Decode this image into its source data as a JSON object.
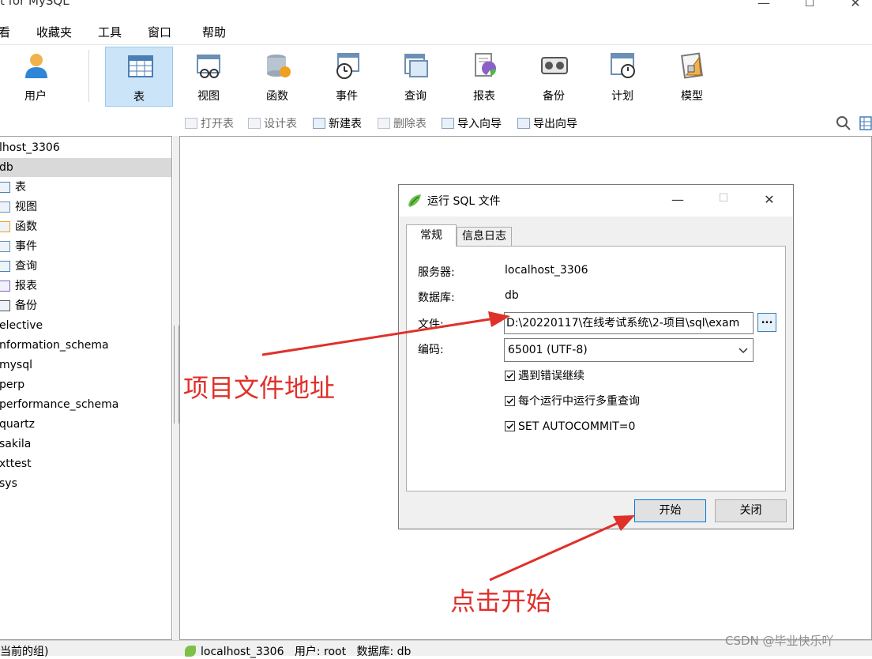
{
  "window": {
    "title_partial": "t for MySQL",
    "minimize": "—",
    "maximize": "☐",
    "close": "✕"
  },
  "menubar": {
    "items": [
      "看",
      "收藏夹",
      "工具",
      "窗口",
      "帮助"
    ]
  },
  "toolbar": {
    "buttons": [
      {
        "label": "用户",
        "icon": "user-icon"
      },
      {
        "label": "表",
        "icon": "table-icon",
        "active": true
      },
      {
        "label": "视图",
        "icon": "view-icon"
      },
      {
        "label": "函数",
        "icon": "function-icon"
      },
      {
        "label": "事件",
        "icon": "event-icon"
      },
      {
        "label": "查询",
        "icon": "query-icon"
      },
      {
        "label": "报表",
        "icon": "report-icon"
      },
      {
        "label": "备份",
        "icon": "backup-icon"
      },
      {
        "label": "计划",
        "icon": "schedule-icon"
      },
      {
        "label": "模型",
        "icon": "model-icon"
      }
    ]
  },
  "subtoolbar": {
    "items": [
      {
        "label": "打开表",
        "enabled": false
      },
      {
        "label": "设计表",
        "enabled": false
      },
      {
        "label": "新建表",
        "enabled": true
      },
      {
        "label": "删除表",
        "enabled": false
      },
      {
        "label": "导入向导",
        "enabled": true
      },
      {
        "label": "导出向导",
        "enabled": true
      }
    ]
  },
  "tree": {
    "rows": [
      {
        "label": "lhost_3306",
        "level": 0
      },
      {
        "label": "db",
        "level": 0,
        "selected": true
      },
      {
        "label": "表",
        "level": 1,
        "icon": "table-icon"
      },
      {
        "label": "视图",
        "level": 1,
        "icon": "view-icon"
      },
      {
        "label": "函数",
        "level": 1,
        "icon": "function-icon"
      },
      {
        "label": "事件",
        "level": 1,
        "icon": "event-icon"
      },
      {
        "label": "查询",
        "level": 1,
        "icon": "query-icon"
      },
      {
        "label": "报表",
        "level": 1,
        "icon": "report-icon"
      },
      {
        "label": "备份",
        "level": 1,
        "icon": "backup-icon"
      },
      {
        "label": "elective",
        "level": 0
      },
      {
        "label": "nformation_schema",
        "level": 0
      },
      {
        "label": "mysql",
        "level": 0
      },
      {
        "label": "perp",
        "level": 0
      },
      {
        "label": "performance_schema",
        "level": 0
      },
      {
        "label": "quartz",
        "level": 0
      },
      {
        "label": "sakila",
        "level": 0
      },
      {
        "label": "xttest",
        "level": 0
      },
      {
        "label": "sys",
        "level": 0
      }
    ]
  },
  "statusbar": {
    "left": "当前的组)",
    "connection": "localhost_3306",
    "user_label": "用户: root",
    "db_label": "数据库: db"
  },
  "dialog": {
    "title": "运行 SQL 文件",
    "tabs": [
      "常规",
      "信息日志"
    ],
    "fields": {
      "server_label": "服务器:",
      "server_value": "localhost_3306",
      "database_label": "数据库:",
      "database_value": "db",
      "file_label": "文件:",
      "file_value": "D:\\20220117\\在线考试系统\\2-项目\\sql\\exam",
      "encoding_label": "编码:",
      "encoding_value": "65001 (UTF-8)"
    },
    "checkboxes": [
      {
        "label": "遇到错误继续",
        "checked": true
      },
      {
        "label": "每个运行中运行多重查询",
        "checked": true
      },
      {
        "label": "SET AUTOCOMMIT=0",
        "checked": true
      }
    ],
    "browse_label": "...",
    "start_label": "开始",
    "close_label": "关闭"
  },
  "annotations": {
    "file_path_note": "项目文件地址",
    "start_note": "点击开始",
    "watermark": "CSDN @毕业快乐吖",
    "color": "#e0302a"
  }
}
